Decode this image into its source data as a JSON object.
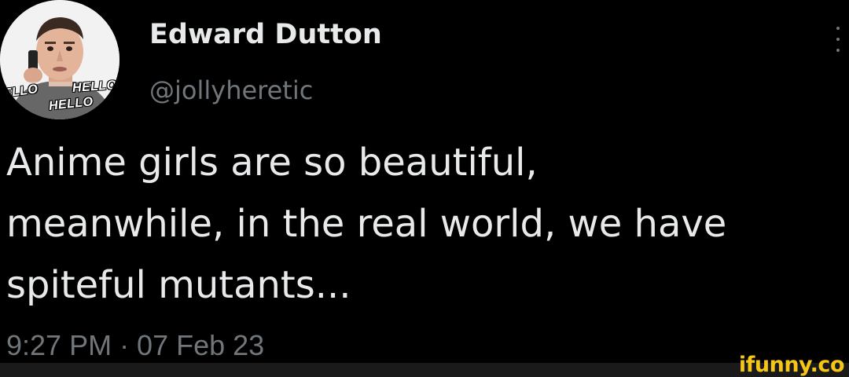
{
  "author": {
    "display_name": "Edward Dutton",
    "handle": "@jollyheretic",
    "avatar_caption": [
      "ELLO",
      "HELLO",
      "HELLO"
    ]
  },
  "tweet": {
    "text_lines": [
      "Anime girls are so beautiful,",
      "meanwhile, in the real world, we have",
      "spiteful mutants..."
    ],
    "timestamp": "9:27 PM · 07 Feb 23"
  },
  "watermark": "ifunny.co",
  "colors": {
    "background": "#000000",
    "primary_text": "#e7e9ea",
    "secondary_text": "#71767b",
    "watermark": "#f5c518"
  },
  "icons": {
    "more": "more-vertical-icon"
  }
}
